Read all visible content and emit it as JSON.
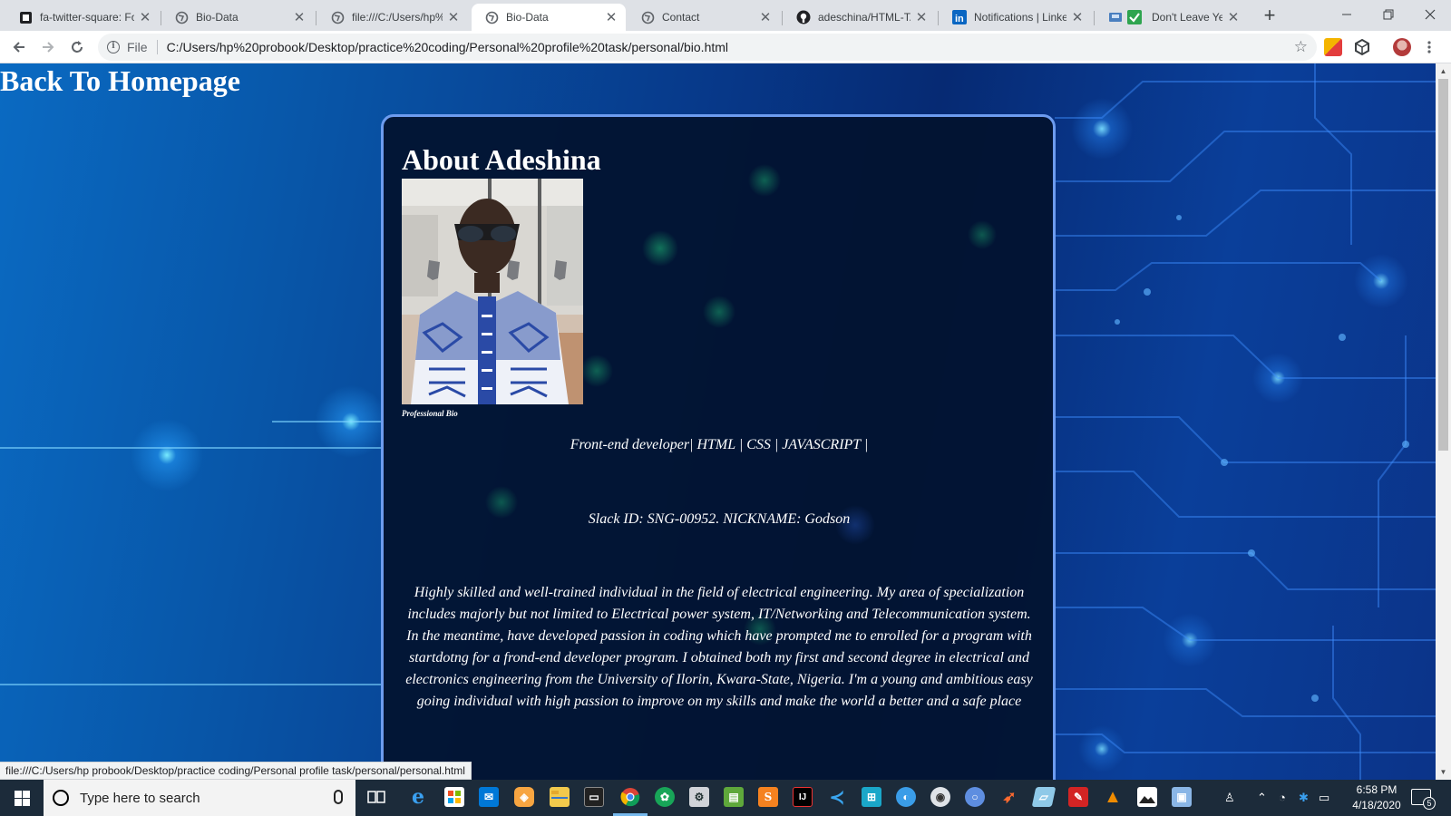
{
  "browser": {
    "tabs": [
      {
        "title": "fa-twitter-square: Fo",
        "icon": "twitter-square-icon",
        "active": false
      },
      {
        "title": "Bio-Data",
        "icon": "globe-icon",
        "active": false
      },
      {
        "title": "file:///C:/Users/hp%",
        "icon": "globe-icon",
        "active": false
      },
      {
        "title": "Bio-Data",
        "icon": "globe-icon",
        "active": true
      },
      {
        "title": "Contact",
        "icon": "globe-icon",
        "active": false
      },
      {
        "title": "adeschina/HTML-TA",
        "icon": "github-icon",
        "active": false
      },
      {
        "title": "Notifications | Linke",
        "icon": "linkedin-icon",
        "active": false
      },
      {
        "title": "Don't Leave Yet!",
        "icon": "checkbox-icon",
        "active": false
      }
    ],
    "scheme_label": "File",
    "url": "C:/Users/hp%20probook/Desktop/practice%20coding/Personal%20profile%20task/personal/bio.html",
    "status_url": "file:///C:/Users/hp probook/Desktop/practice coding/Personal profile task/personal/personal.html"
  },
  "page": {
    "back_link": "Back To Homepage",
    "heading": "About Adeshina",
    "photo_caption": "Professional Bio",
    "role_line": "Front-end developer| HTML | CSS | JAVASCRIPT |",
    "slack_line": "Slack ID: SNG-00952. NICKNAME: Godson",
    "bio": "Highly skilled and well-trained individual in the field of electrical engineering. My area of specialization includes majorly but not limited to Electrical power system, IT/Networking and Telecommunication system. In the meantime, have developed passion in coding which have prompted me to enrolled for a program with startdotng for a frond-end developer program. I obtained both my first and second degree in electrical and electronics engineering from the University of Ilorin, Kwara-State, Nigeria. I'm a young and ambitious easy going individual with high passion to improve on my skills and make the world a better and a safe place",
    "colors": {
      "card_border": "#6d9cef",
      "background_blue": "#07398a"
    }
  },
  "taskbar": {
    "search_placeholder": "Type here to search",
    "time": "6:58 PM",
    "date": "4/18/2020",
    "notification_count": "5"
  }
}
